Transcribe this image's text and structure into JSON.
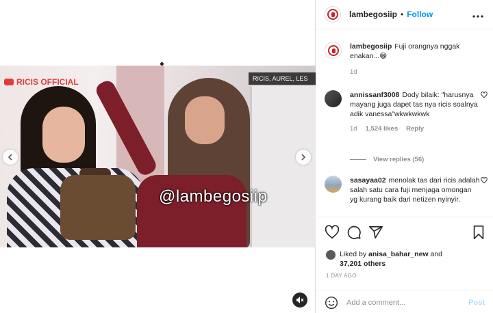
{
  "post": {
    "username": "lambegosiip",
    "separator": "•",
    "follow_label": "Follow",
    "more_icon": "more-icon"
  },
  "media": {
    "watermark_left": "RICIS OFFICIAL",
    "watermark_right": "RICIS, AUREL, LES",
    "watermark_center": "@lambegosiip",
    "prev_icon": "chevron-left-icon",
    "next_icon": "chevron-right-icon",
    "mute_icon": "speaker-muted-icon"
  },
  "caption": {
    "username": "lambegosiip",
    "text": "Fuji orangnya nggak enakan...😁",
    "time": "1d"
  },
  "comments": [
    {
      "username": "annissanf3008",
      "text": "Dody bilaik: \"harusnya mayang juga dapet tas nya ricis soalnya adik vanessa\"wkwkwkwk",
      "time": "1d",
      "likes": "1,524 likes",
      "reply": "Reply",
      "view_replies": "View replies (56)"
    },
    {
      "username": "sasayaa02",
      "text": "menolak tas dari ricis adalah salah satu cara fuji menjaga omongan yg kurang baik dari netizen nyinyir."
    }
  ],
  "likes": {
    "prefix": "Liked by",
    "user": "anisa_bahar_new",
    "and": "and",
    "others": "37,201 others"
  },
  "timestamp": "1 DAY AGO",
  "add_comment": {
    "placeholder": "Add a comment...",
    "post_label": "Post"
  },
  "colors": {
    "accent": "#0095f6",
    "post_disabled": "#b2dffc",
    "brand_red": "#c4232b"
  }
}
